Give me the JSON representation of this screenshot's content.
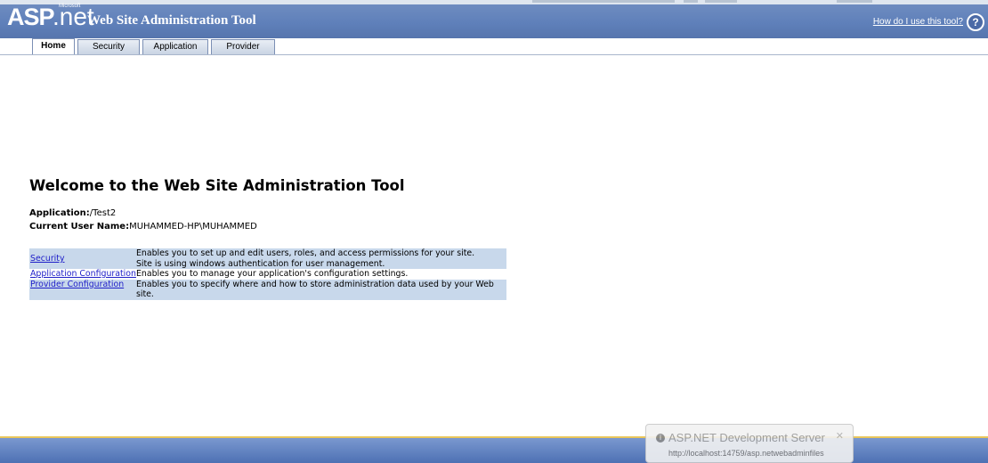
{
  "header": {
    "logo_asp": "ASP",
    "logo_net": ".net",
    "logo_ms": "Microsoft",
    "title": "Web Site Administration Tool",
    "help_link": "How do I use this tool?",
    "help_icon": "?"
  },
  "tabs": [
    {
      "label": "Home",
      "active": true
    },
    {
      "label": "Security",
      "active": false
    },
    {
      "label": "Application",
      "active": false
    },
    {
      "label": "Provider",
      "active": false
    }
  ],
  "main": {
    "welcome": "Welcome to the Web Site Administration Tool",
    "application_label": "Application:",
    "application_value": "/Test2",
    "user_label": "Current User Name:",
    "user_value": "MUHAMMED-HP\\MUHAMMED",
    "links": [
      {
        "label": "Security",
        "desc1": "Enables you to set up and edit users, roles, and access permissions for your site.",
        "desc2": "Site is using windows authentication for user management."
      },
      {
        "label": "Application Configuration",
        "desc1": "Enables you to manage your application's configuration settings."
      },
      {
        "label": "Provider Configuration",
        "desc1": "Enables you to specify where and how to store administration data used by your Web site."
      }
    ]
  },
  "notification": {
    "icon": "i",
    "title": "ASP.NET Development Server",
    "url": "http://localhost:14759/asp.netwebadminfiles",
    "close": "✕"
  },
  "colors": {
    "header_blue": "#5f80ba",
    "row_blue": "#c8d8eb",
    "link_blue": "#1d1dc8"
  }
}
